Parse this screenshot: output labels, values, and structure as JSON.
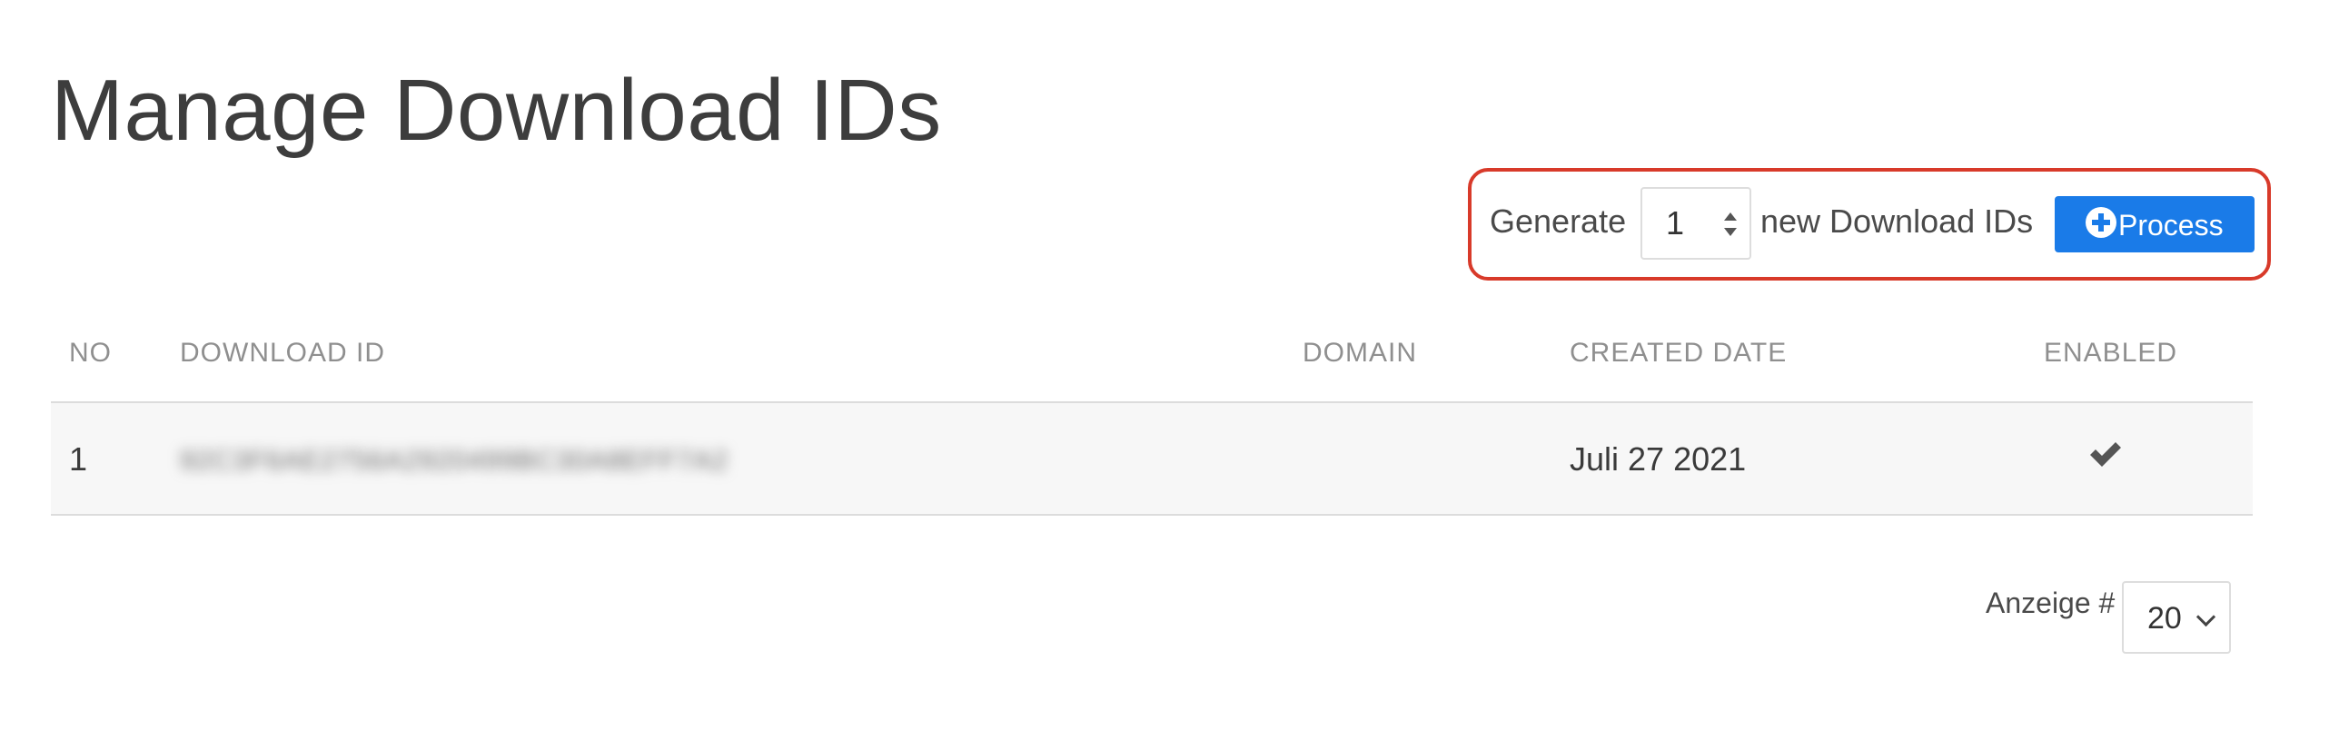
{
  "page": {
    "title": "Manage Download IDs"
  },
  "generator": {
    "label_prefix": "Generate",
    "count_value": "1",
    "label_suffix": "new Download IDs",
    "process_label": "Process",
    "process_icon": "plus-circle-icon",
    "button_color": "#1a7be8",
    "highlight_color": "#d83a2a"
  },
  "table": {
    "columns": {
      "no": "NO",
      "download_id": "DOWNLOAD ID",
      "domain": "DOMAIN",
      "created_date": "CREATED DATE",
      "enabled": "ENABLED"
    },
    "rows": [
      {
        "no": "1",
        "download_id": "92C3F6AE2756A2920499BC30A8EFF7A2",
        "domain": "",
        "created_date": "Juli 27 2021",
        "enabled": true,
        "enabled_icon": "check-icon"
      }
    ]
  },
  "pagination": {
    "label": "Anzeige #",
    "per_page": "20"
  }
}
